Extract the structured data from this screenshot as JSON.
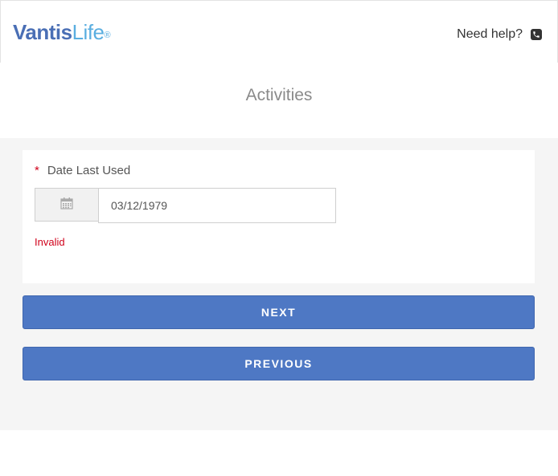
{
  "header": {
    "logo": {
      "brand": "Vantis",
      "product": "Life",
      "reg": "®"
    },
    "help_label": "Need help?",
    "help_icon": "phone-icon"
  },
  "page": {
    "title": "Activities"
  },
  "form": {
    "required_marker": "*",
    "date_label": "Date Last Used",
    "date_value": "03/12/1979",
    "calendar_icon": "calendar-icon",
    "error_text": "Invalid"
  },
  "actions": {
    "next_label": "NEXT",
    "previous_label": "PREVIOUS"
  },
  "colors": {
    "brand_primary": "#4a6fb5",
    "brand_secondary": "#5aaee0",
    "button": "#4e78c4",
    "error": "#d0021b",
    "background": "#f5f5f5"
  }
}
